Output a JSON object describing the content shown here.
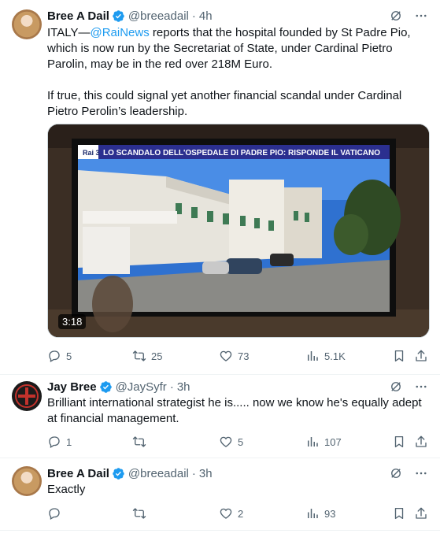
{
  "tweets": [
    {
      "name": "Bree A Dail",
      "handle": "@breeadail",
      "time": "4h",
      "text_before": "ITALY—",
      "mention": "@RaiNews",
      "text_after": " reports that the hospital founded by St Padre Pio, which is now run by the Secretariat of State, under Cardinal Pietro Parolin, may be in the red over 218M Euro.",
      "text_para2": "If true, this could signal yet another financial scandal under Cardinal Pietro Perolin’s leadership.",
      "video": {
        "tv_banner": "LO SCANDALO DELL'OSPEDALE DI PADRE PIO: RISPONDE IL VATICANO",
        "tv_channel": "Rai 3",
        "duration": "3:18"
      },
      "replies": "5",
      "reposts": "25",
      "likes": "73",
      "views": "5.1K"
    },
    {
      "name": "Jay Bree",
      "handle": "@JaySyfr",
      "time": "3h",
      "text": "Brilliant international strategist he is..... now we know he's equally adept at financial management.",
      "replies": "1",
      "reposts": "",
      "likes": "5",
      "views": "107"
    },
    {
      "name": "Bree A Dail",
      "handle": "@breeadail",
      "time": "3h",
      "text": "Exactly",
      "replies": "",
      "reposts": "",
      "likes": "2",
      "views": "93"
    }
  ],
  "colors": {
    "verified": "#1d9bf0",
    "muted": "#536471",
    "link": "#1d9bf0",
    "tv_banner_bg": "#2b2f8f"
  },
  "icons": [
    "verified-badge-icon",
    "grok-icon",
    "more-icon",
    "reply-icon",
    "repost-icon",
    "like-icon",
    "views-icon",
    "bookmark-icon",
    "share-icon"
  ]
}
